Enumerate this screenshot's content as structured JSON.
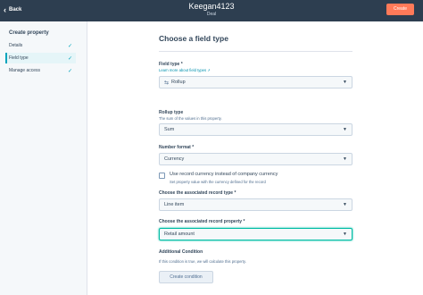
{
  "header": {
    "back_label": "Back",
    "title": "Keegan4123",
    "subtitle": "Deal",
    "create_label": "Create"
  },
  "sidebar": {
    "heading": "Create property",
    "items": [
      {
        "label": "Details",
        "done": true
      },
      {
        "label": "Field type",
        "done": true
      },
      {
        "label": "Manage access",
        "done": true
      }
    ]
  },
  "main": {
    "heading": "Choose a field type",
    "field_type": {
      "label": "Field type *",
      "link": "Learn more about field types",
      "value": "Rollup"
    },
    "rollup_type": {
      "label": "Rollup type",
      "help": "The sum of the values in this property.",
      "value": "Sum"
    },
    "number_format": {
      "label": "Number format *",
      "value": "Currency"
    },
    "record_currency": {
      "label": "Use record currency instead of company currency",
      "help": "Set property value with the currency defined for the record"
    },
    "record_type": {
      "label": "Choose the associated record type *",
      "value": "Line item"
    },
    "record_property": {
      "label": "Choose the associated record property *",
      "value": "Retail amount"
    },
    "condition": {
      "label": "Additional Condition",
      "help": "If this condition is true, we will calculate this property.",
      "button": "Create condition"
    }
  },
  "colors": {
    "header_bg": "#2d3e50",
    "accent": "#ff7a59",
    "teal": "#00a4bd"
  }
}
